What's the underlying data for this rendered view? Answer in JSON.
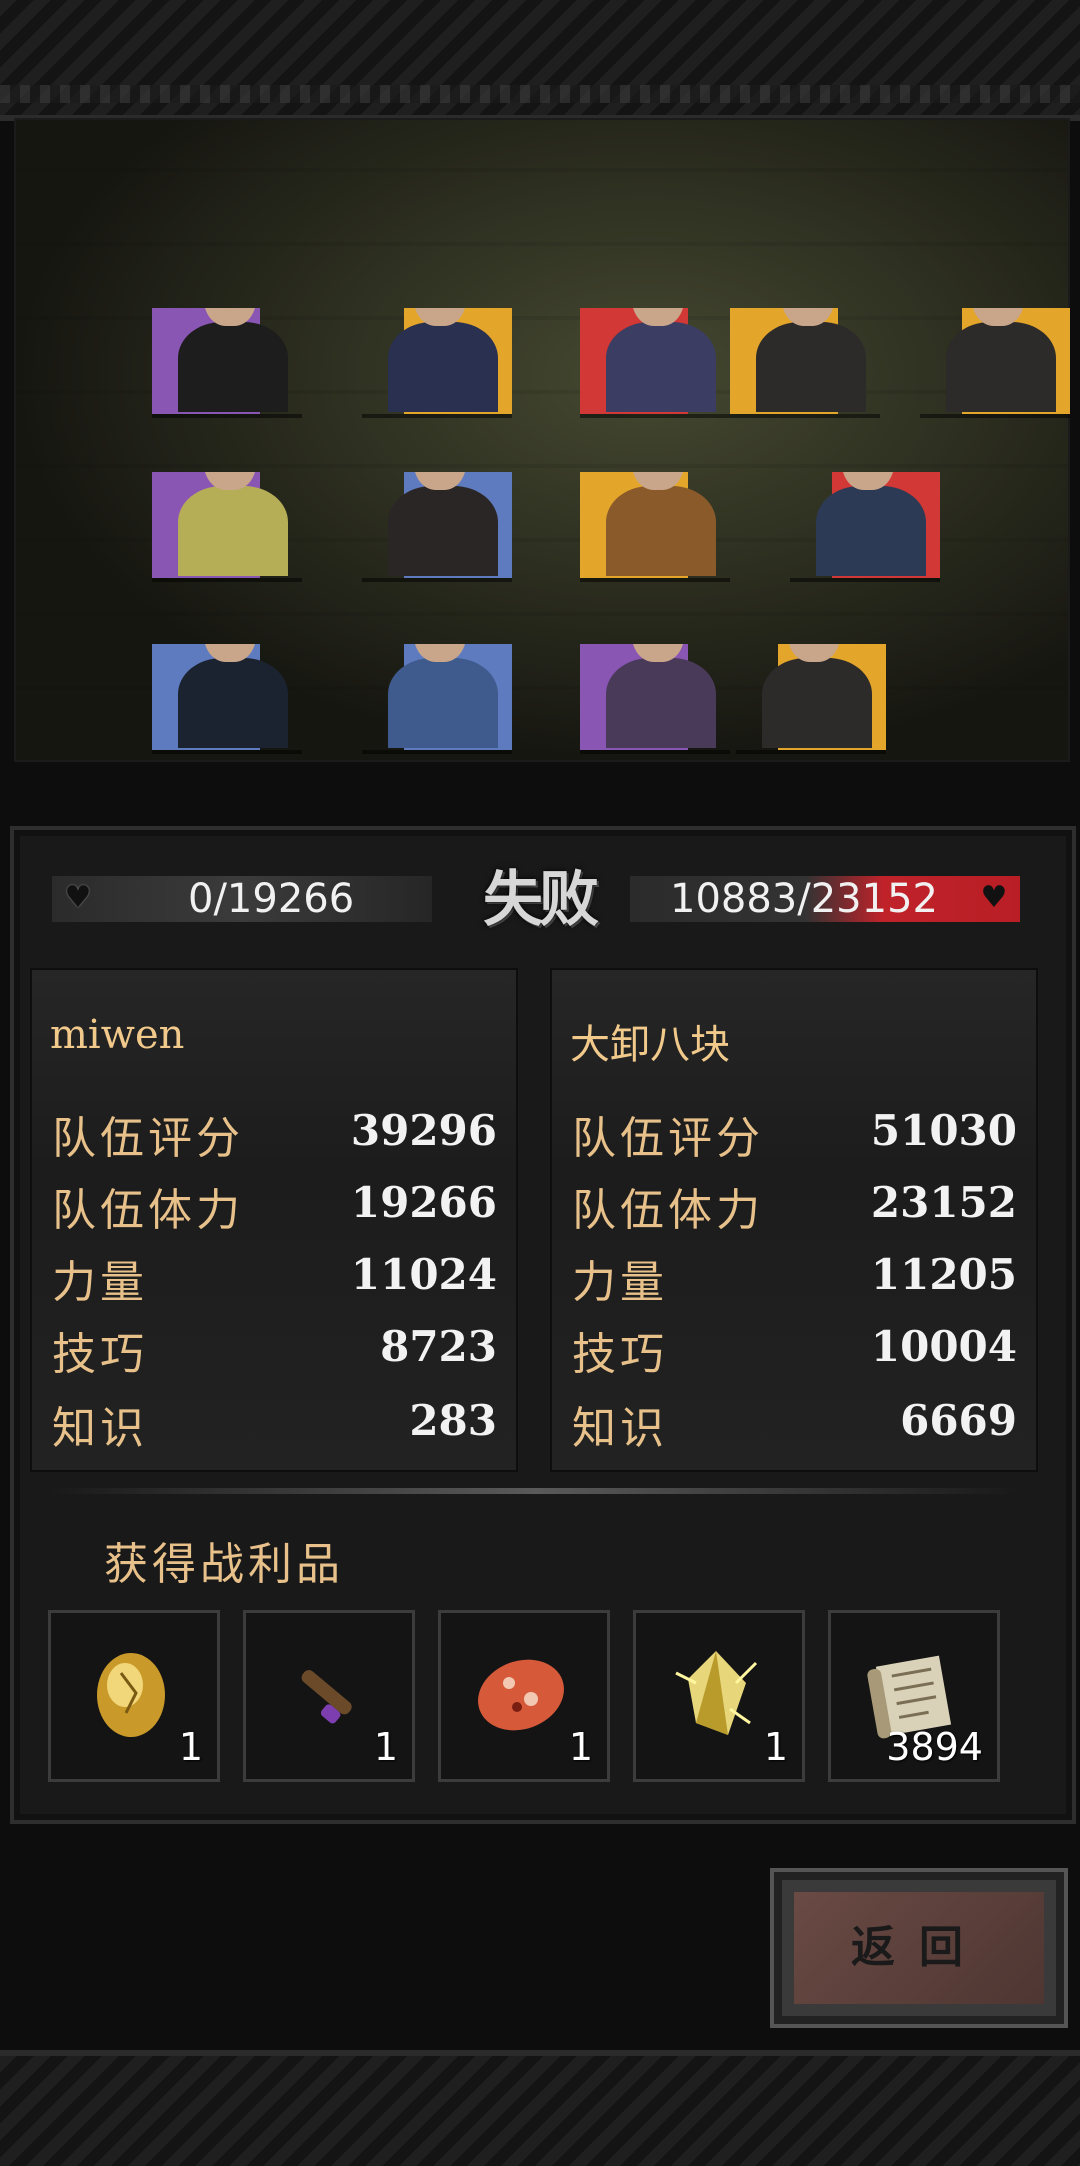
{
  "battle": {
    "result": "失败",
    "left_hp": "0/19266",
    "right_hp": "10883/23152"
  },
  "player": {
    "name": "miwen",
    "stats": [
      {
        "label": "队伍评分",
        "value": "39296"
      },
      {
        "label": "队伍体力",
        "value": "19266"
      },
      {
        "label": "力量",
        "value": "11024"
      },
      {
        "label": "技巧",
        "value": "8723"
      },
      {
        "label": "知识",
        "value": "283"
      }
    ]
  },
  "opponent": {
    "name": "大卸八块",
    "stats": [
      {
        "label": "队伍评分",
        "value": "51030"
      },
      {
        "label": "队伍体力",
        "value": "23152"
      },
      {
        "label": "力量",
        "value": "11205"
      },
      {
        "label": "技巧",
        "value": "10004"
      },
      {
        "label": "知识",
        "value": "6669"
      }
    ]
  },
  "loot": {
    "title": "获得战利品",
    "items": [
      {
        "icon": "golden-egg-icon",
        "count": "1"
      },
      {
        "icon": "scroll-tube-icon",
        "count": "1"
      },
      {
        "icon": "spotted-stone-icon",
        "count": "1"
      },
      {
        "icon": "crystal-shard-icon",
        "count": "1"
      },
      {
        "icon": "blueprint-scroll-icon",
        "count": "3894"
      }
    ]
  },
  "buttons": {
    "return_label": "返回"
  },
  "colors": {
    "purple": "#8a56b3",
    "yellow": "#e3a52a",
    "blue": "#5e7bbf",
    "red": "#d23835",
    "gold_text": "#e7c08a"
  }
}
